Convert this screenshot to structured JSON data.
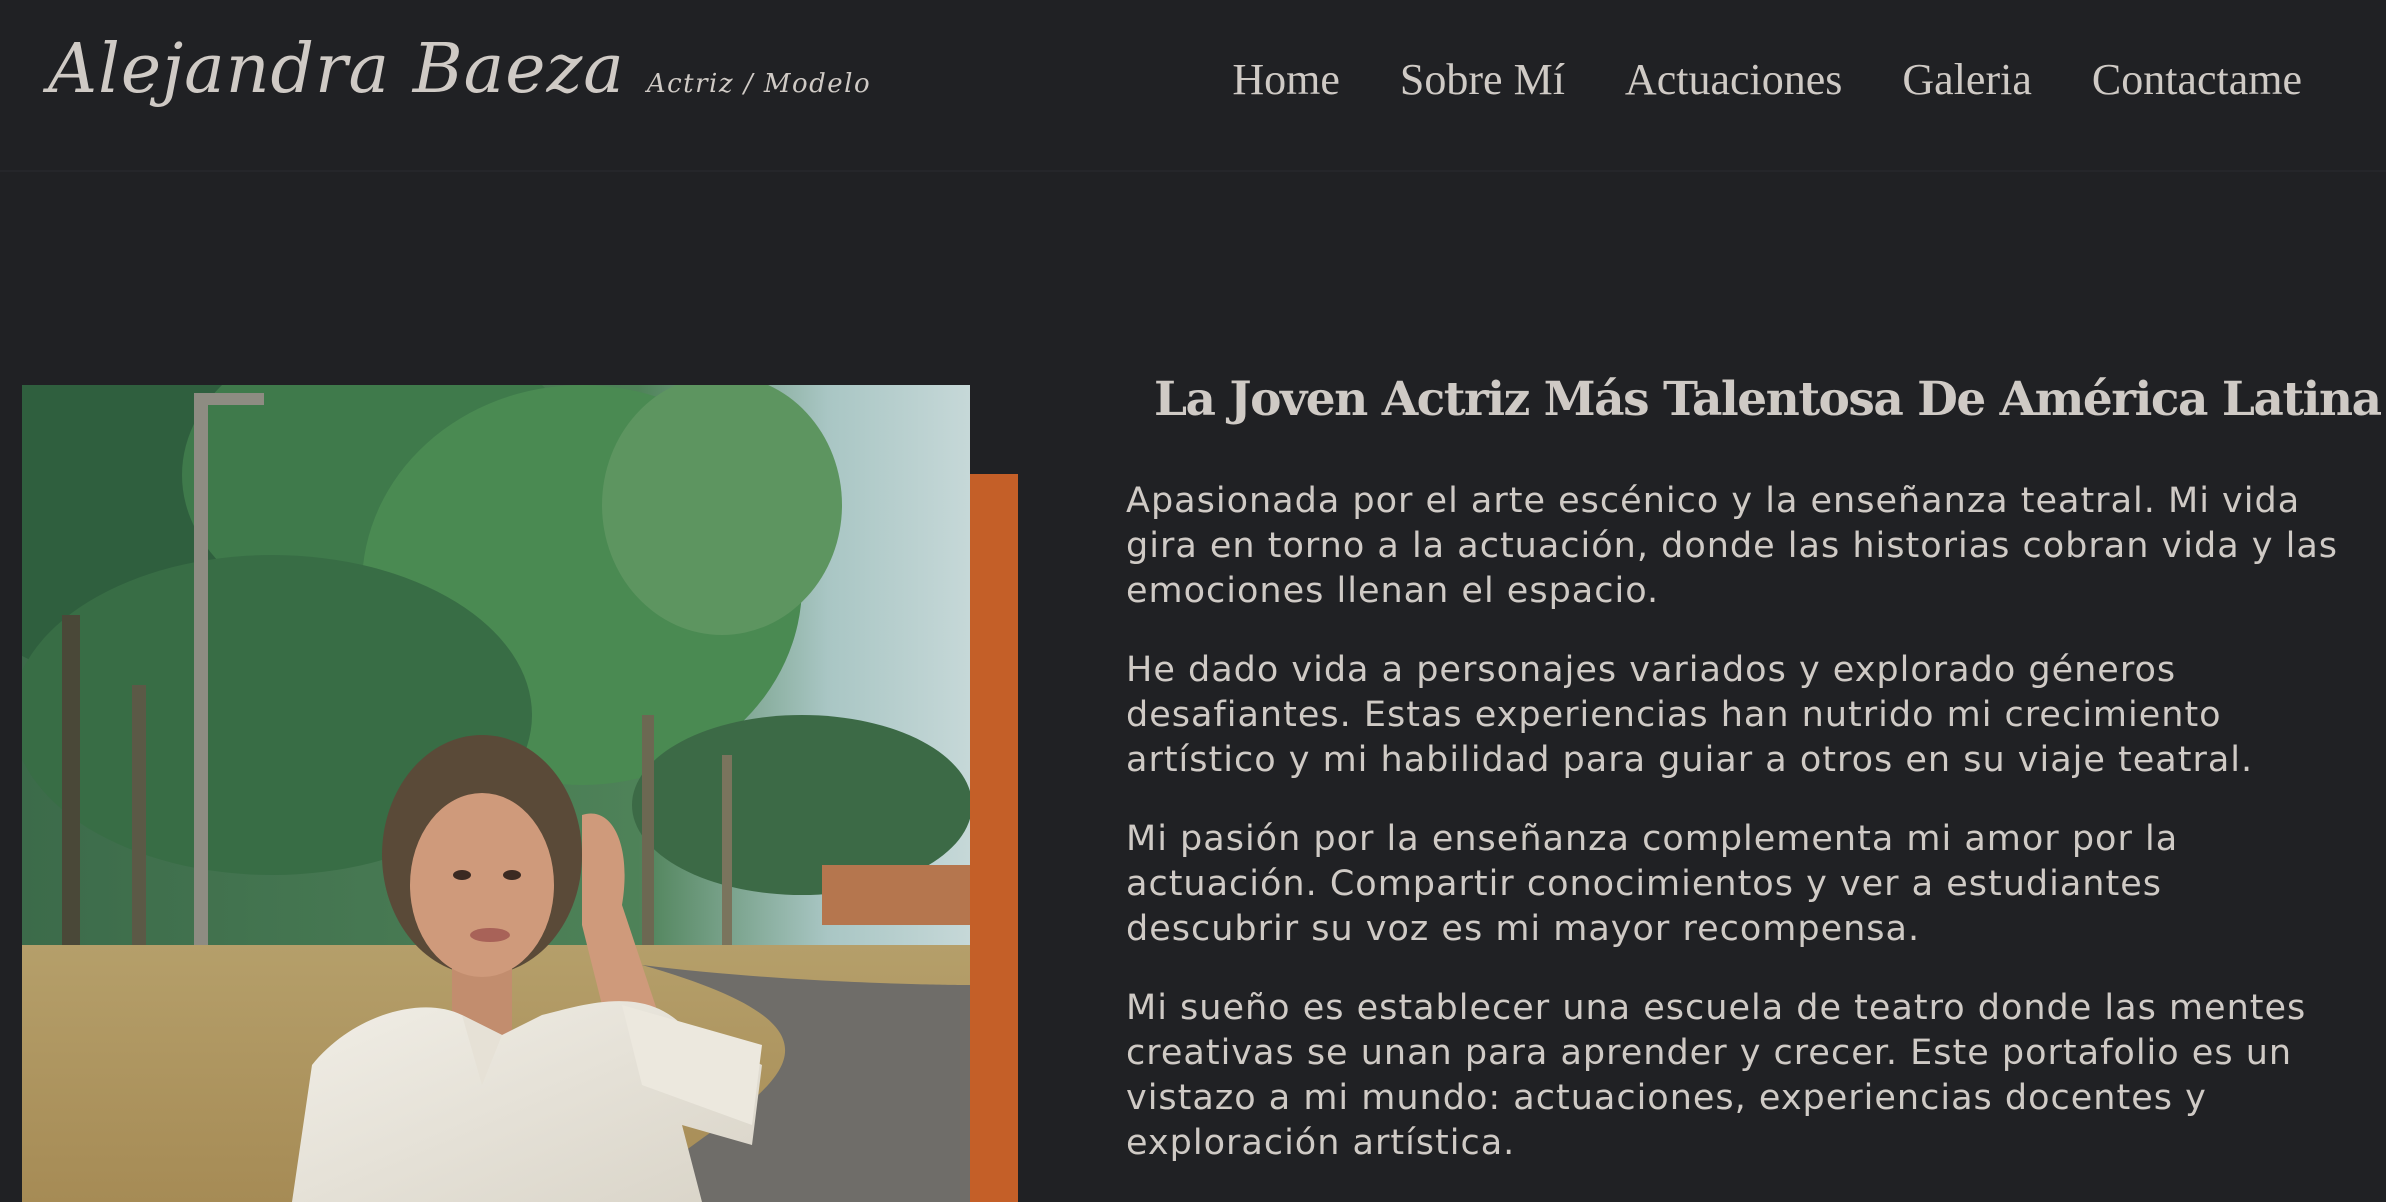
{
  "brand": {
    "name": "Alejandra Baeza",
    "subtitle": "Actriz / Modelo"
  },
  "nav": {
    "items": [
      {
        "label": "Home"
      },
      {
        "label": "Sobre Mí"
      },
      {
        "label": "Actuaciones"
      },
      {
        "label": "Galeria"
      },
      {
        "label": "Contactame"
      }
    ]
  },
  "about": {
    "headline": "La Joven Actriz Más Talentosa De América Latina",
    "paragraphs": [
      "Apasionada por el arte escénico y la enseñanza teatral. Mi vida gira en torno a la actuación, donde las historias cobran vida y las emociones llenan el espacio.",
      "He dado vida a personajes variados y explorado géneros desafiantes. Estas experiencias han nutrido mi crecimiento artístico y mi habilidad para guiar a otros en su viaje teatral.",
      "Mi pasión por la enseñanza complementa mi amor por la actuación. Compartir conocimientos y ver a estudiantes descubrir su voz es mi mayor recompensa.",
      "Mi sueño es establecer una escuela de teatro donde las mentes creativas se unan para aprender y crecer. Este portafolio es un vistazo a mi mundo: actuaciones, experiencias docentes y exploración artística."
    ]
  },
  "colors": {
    "background": "#202124",
    "text": "#cfcac5",
    "accent": "#c45f28"
  }
}
